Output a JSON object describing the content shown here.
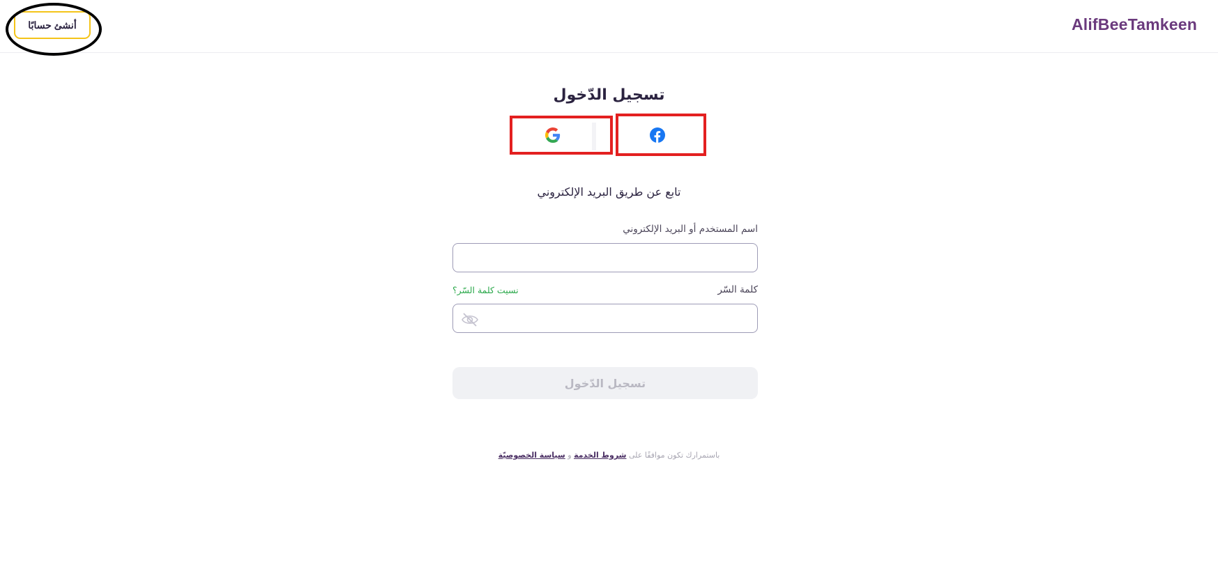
{
  "header": {
    "logo": "AlifBeeTamkeen",
    "signup_label": "أنشئ حسابًا"
  },
  "login": {
    "title": "تسجيل الدّخول",
    "subtitle": "تابع عن طريق البريد الإلكتروني",
    "username_label": "اسم المستخدم أو البريد الإلكتروني",
    "username_value": "",
    "password_label": "كلمة السّر",
    "password_value": "",
    "forgot_label": "نسيت كلمة السّر؟",
    "submit_label": "تسجيل الدّخول"
  },
  "social": {
    "google_icon": "google-icon",
    "facebook_icon": "facebook-icon"
  },
  "footer": {
    "prefix": "باستمرارك تكون موافقًا على",
    "terms_label": "شروط الخدمة",
    "and": "و",
    "privacy_label": "سياسة الخصوصيّة"
  },
  "colors": {
    "brand": "#6b3a7d",
    "signup_border": "#f4c419",
    "forgot_link": "#2aa84a",
    "highlight_box": "#e32020",
    "highlight_ring": "#000000"
  }
}
